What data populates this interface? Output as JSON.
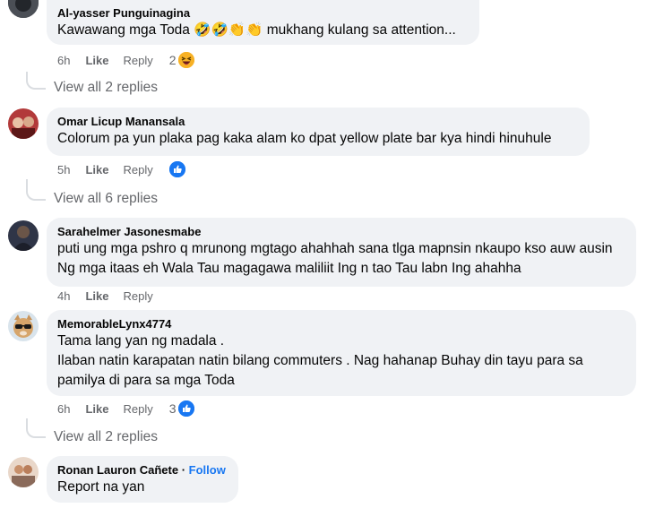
{
  "comments": [
    {
      "author": "Al-yasser Punguinagina",
      "text": "Kawawang mga Toda 🤣🤣👏👏 mukhang kulang sa attention...",
      "time": "6h",
      "like": "Like",
      "reply": "Reply",
      "reaction_count": "2",
      "reaction_icon": "laugh-emoji-icon",
      "view_replies": "View all 2 replies"
    },
    {
      "author": "Omar Licup Manansala",
      "text": "Colorum pa yun plaka pag kaka alam ko dpat yellow plate bar kya hindi hinuhule",
      "time": "5h",
      "like": "Like",
      "reply": "Reply",
      "reaction_icon": "thumbs-up-icon",
      "view_replies": "View all 6 replies"
    },
    {
      "author": "Sarahelmer Jasonesmabe",
      "text": "puti ung mga pshro q mrunong mgtago ahahhah sana tlga mapnsin nkaupo kso auw ausin Ng mga itaas eh Wala Tau magagawa maliliit Ing n tao Tau labn Ing ahahha",
      "time": "4h",
      "like": "Like",
      "reply": "Reply"
    },
    {
      "author": "MemorableLynx4774",
      "text": "Tama lang yan ng madala .\nIlaban natin karapatan natin bilang commuters . Nag hahanap Buhay din tayu para sa pamilya di para sa mga Toda",
      "time": "6h",
      "like": "Like",
      "reply": "Reply",
      "reaction_count": "3",
      "reaction_icon": "thumbs-up-icon",
      "view_replies": "View all 2 replies"
    },
    {
      "author": "Ronan Lauron Cañete",
      "separator": "·",
      "follow": "Follow",
      "text": "Report na yan"
    }
  ],
  "colors": {
    "bubble": "#f0f2f5",
    "secondary_text": "#65676b",
    "like_blue": "#1877f2"
  }
}
